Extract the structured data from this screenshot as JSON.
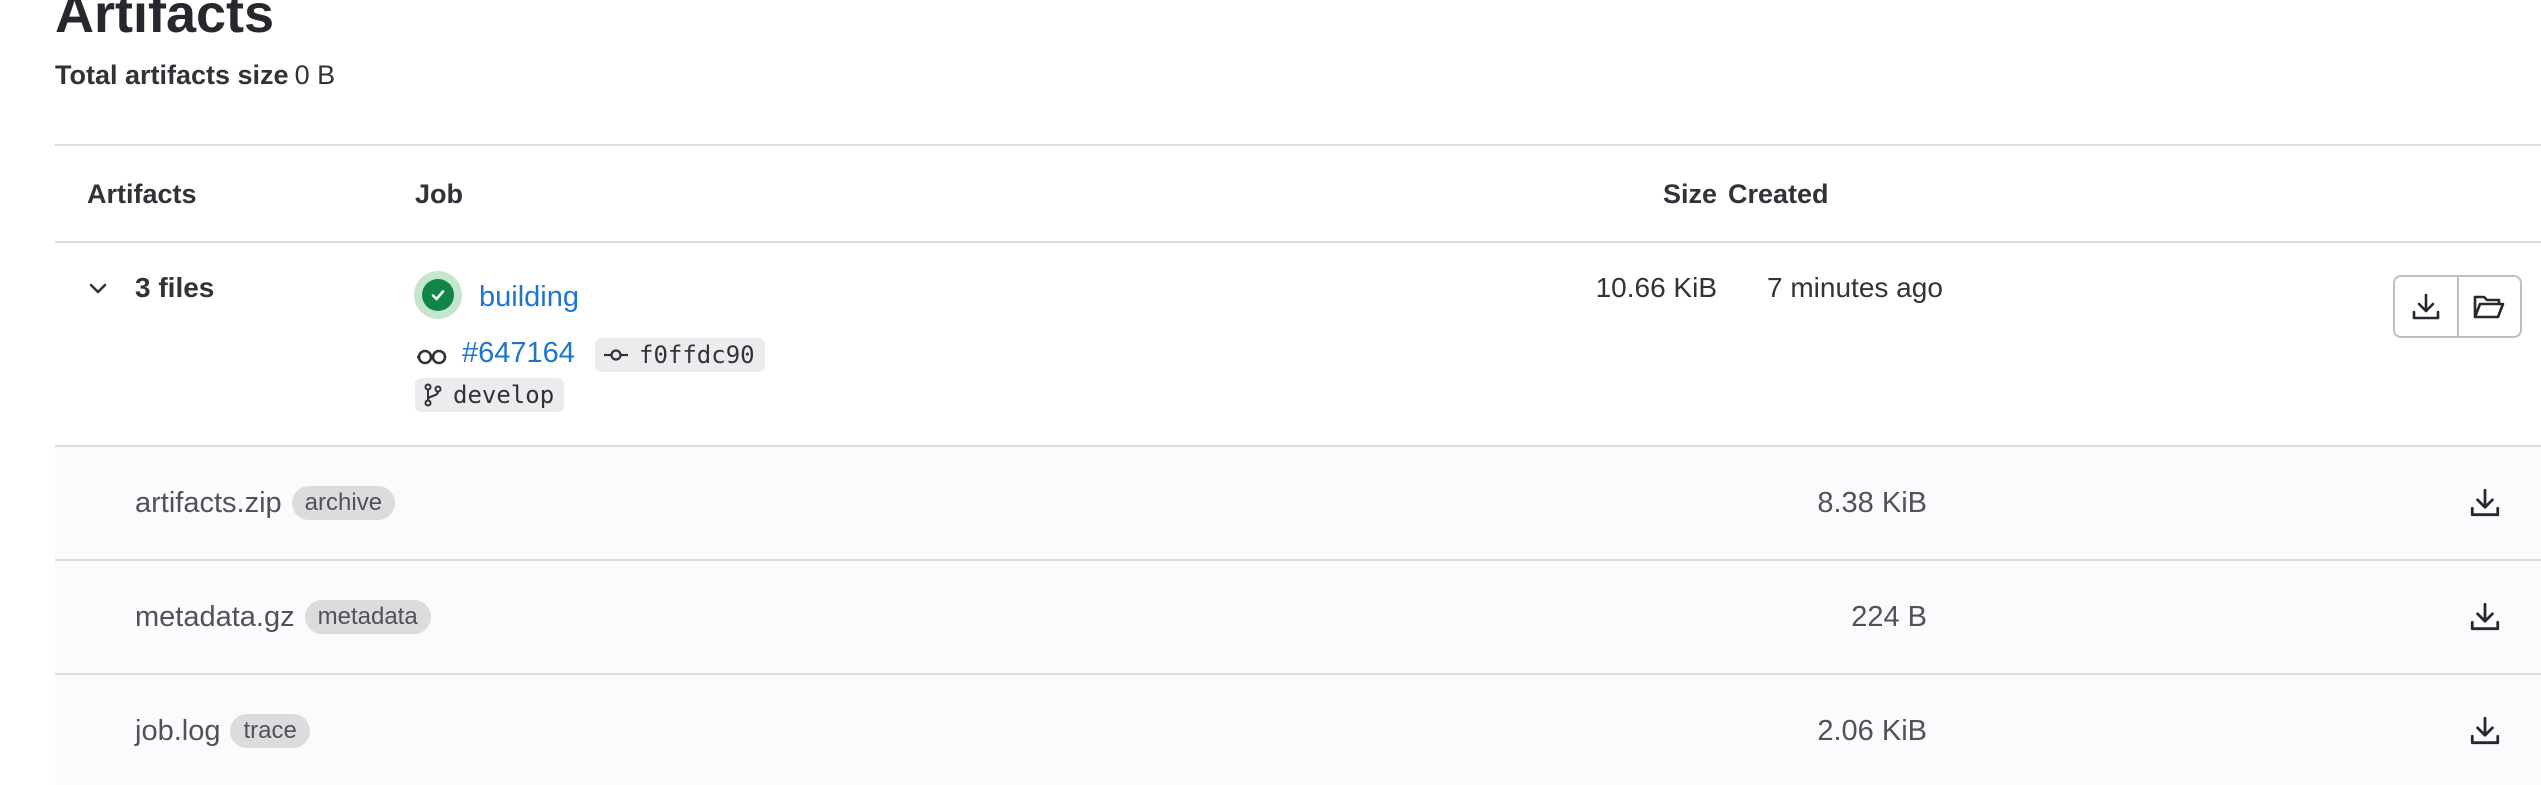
{
  "page": {
    "title": "Artifacts",
    "total_size_label": "Total artifacts size",
    "total_size_value": "0 B"
  },
  "table": {
    "headers": {
      "artifacts": "Artifacts",
      "job": "Job",
      "size": "Size",
      "created": "Created"
    },
    "job_row": {
      "files_toggle": "3 files",
      "status": "success",
      "job_name": "building",
      "pipeline_id": "#647164",
      "commit_sha": "f0ffdc90",
      "branch": "develop",
      "size": "10.66 KiB",
      "created": "7 minutes ago",
      "icons": {
        "toggle": "chevron-down-icon",
        "status": "status-success-icon",
        "pipeline": "pipeline-icon",
        "commit": "commit-icon",
        "branch": "branch-icon",
        "download": "download-icon",
        "browse": "folder-open-icon"
      }
    },
    "files": [
      {
        "name": "artifacts.zip",
        "type": "archive",
        "size": "8.38 KiB"
      },
      {
        "name": "metadata.gz",
        "type": "metadata",
        "size": "224 B"
      },
      {
        "name": "job.log",
        "type": "trace",
        "size": "2.06 KiB"
      }
    ]
  },
  "colors": {
    "link": "#1f75cb",
    "success": "#108548",
    "border": "#dcdcde",
    "row_bg": "#fbfafd"
  }
}
